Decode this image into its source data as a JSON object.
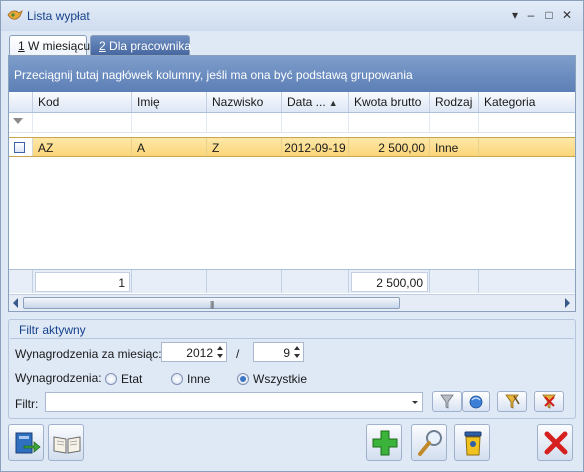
{
  "window": {
    "title": "Lista wypłat",
    "controls": [
      "▾",
      "–",
      "□",
      "✕"
    ]
  },
  "tabs": [
    {
      "key": "1",
      "label": " W miesiącu",
      "active": true
    },
    {
      "key": "2",
      "label": " Dla pracownika",
      "active": false
    }
  ],
  "grid": {
    "group_hint": "Przeciągnij tutaj nagłówek kolumny, jeśli ma ona być podstawą grupowania",
    "columns": [
      "Kod",
      "Imię",
      "Nazwisko",
      "Data ...",
      "Kwota brutto",
      "Rodzaj",
      "Kategoria"
    ],
    "sorted_column": "Data ...",
    "sort_indicator": "▲",
    "rows": [
      {
        "kod": "AZ",
        "imie": "A",
        "nazwisko": "Z",
        "data": "2012-09-19",
        "kwota": "2 500,00",
        "rodzaj": "Inne",
        "kategoria": ""
      }
    ],
    "summary": {
      "count": "1",
      "kwota": "2 500,00"
    },
    "scroll_grip": "|||"
  },
  "filter_panel": {
    "title": "Filtr aktywny",
    "month_label": "Wynagrodzenia za miesiąc:",
    "year": "2012",
    "separator": "/",
    "month": "9",
    "type_label": "Wynagrodzenia:",
    "options": [
      {
        "label": "Etat",
        "selected": false
      },
      {
        "label": "Inne",
        "selected": false
      },
      {
        "label": "Wszystkie",
        "selected": true
      }
    ],
    "filter_label": "Filtr:",
    "filter_value": ""
  },
  "colors": {
    "group_bar": "#6b8cc0",
    "selected_row": "#fcd679",
    "tab_inactive": "#5677ad",
    "frame": "#dfe8f5"
  },
  "icons": [
    "app-icon",
    "funnel-icon",
    "funnel-globe-icon",
    "funnel-clear-icon",
    "funnel-delete-icon",
    "export-icon",
    "book-icon",
    "add-icon",
    "magnifier-icon",
    "delete-bin-icon",
    "close-icon"
  ]
}
